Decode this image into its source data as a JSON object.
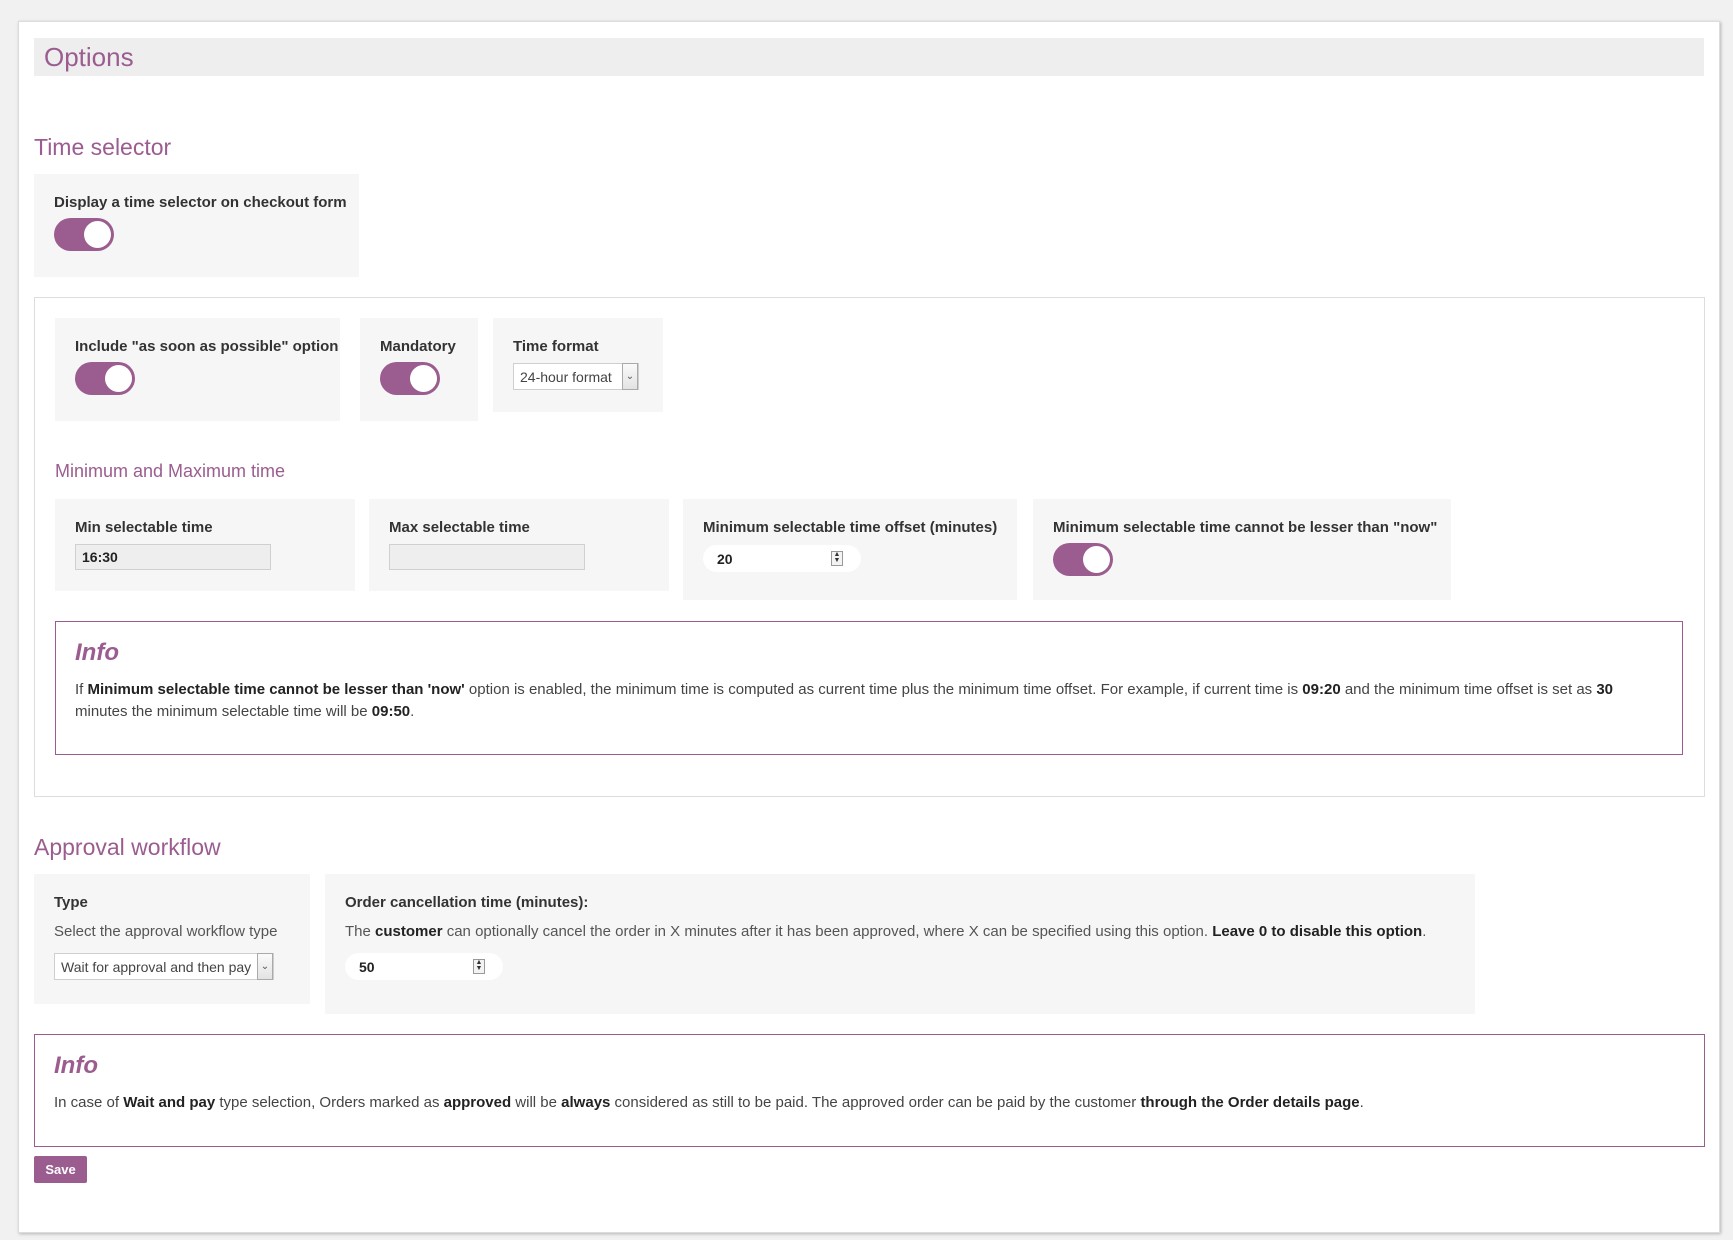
{
  "page": {
    "title": "Options"
  },
  "time_selector": {
    "title": "Time selector",
    "display": {
      "label": "Display a time selector on checkout form",
      "enabled": true
    },
    "asap": {
      "label": "Include \"as soon as possible\" option",
      "enabled": true
    },
    "mandatory": {
      "label": "Mandatory",
      "enabled": true
    },
    "time_format": {
      "label": "Time format",
      "value": "24-hour format"
    },
    "minmax": {
      "title": "Minimum and Maximum time",
      "min": {
        "label": "Min selectable time",
        "value": "16:30"
      },
      "max": {
        "label": "Max selectable time",
        "value": ""
      },
      "offset": {
        "label": "Minimum selectable time offset (minutes)",
        "value": "20"
      },
      "not_lesser_now": {
        "label": "Minimum selectable time cannot be lesser than \"now\"",
        "enabled": true
      }
    },
    "info": {
      "title": "Info",
      "t1": "If ",
      "b1": "Minimum selectable time cannot be lesser than 'now'",
      "t2": " option is enabled, the minimum time is computed as current time plus the minimum time offset. For example, if current time is ",
      "b2": "09:20",
      "t3": " and the minimum time offset is set as ",
      "b3": "30",
      "t4": " minutes the minimum selectable time will be ",
      "b4": "09:50",
      "t5": "."
    }
  },
  "approval": {
    "title": "Approval workflow",
    "type": {
      "label": "Type",
      "description": "Select the approval workflow type",
      "value": "Wait for approval and then pay"
    },
    "cancellation": {
      "label": "Order cancellation time (minutes):",
      "t1": "The ",
      "b1": "customer",
      "t2": " can optionally cancel the order in X minutes after it has been approved, where X can be specified using this option. ",
      "b2": "Leave 0 to disable this option",
      "t3": ".",
      "value": "50"
    },
    "info": {
      "title": "Info",
      "t1": "In case of ",
      "b1": "Wait and pay",
      "t2": " type selection, Orders marked as ",
      "b2": "approved",
      "t3": " will be ",
      "b3": "always",
      "t4": " considered as still to be paid. The approved order can be paid by the customer ",
      "b4": "through the Order details page",
      "t5": "."
    }
  },
  "save_label": "Save",
  "colors": {
    "accent": "#9b5c8f",
    "card_bg": "#f6f6f6",
    "page_bg": "#f1f1f1"
  },
  "icons": {
    "select_arrow": "chevron-down-icon",
    "spinner": "spinner-icon"
  }
}
